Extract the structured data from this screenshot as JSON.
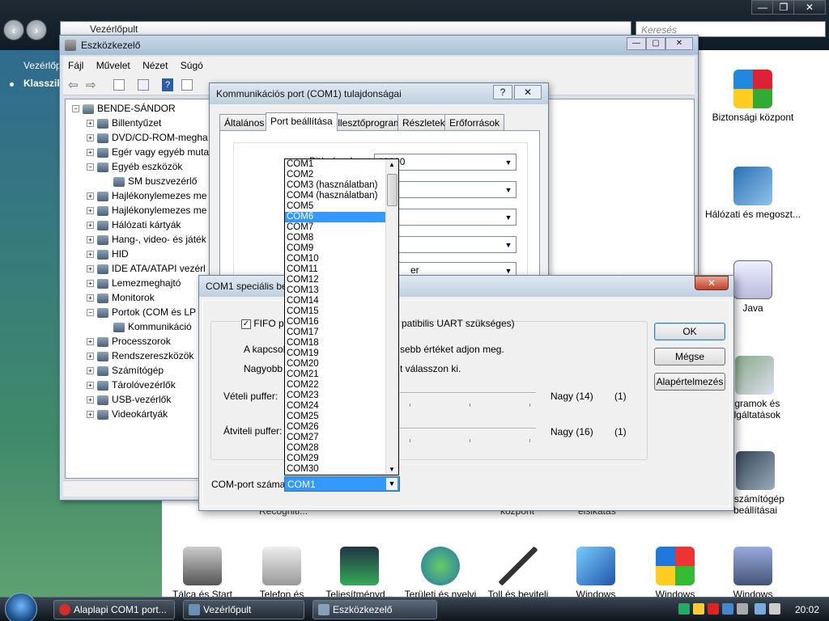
{
  "control_panel": {
    "address": "Vezérlőpult",
    "search_placeholder": "Keresés",
    "left_items": [
      "Vezérlőp",
      "Klasszik"
    ],
    "icons_right": [
      {
        "label": "Biztonsági központ",
        "icon": "security-shield-icon"
      },
      {
        "label": "Hálózati és megoszt...",
        "icon": "network-icon"
      },
      {
        "label": "Java",
        "icon": "java-icon"
      },
      {
        "label": "ogramok és olgáltatások",
        "icon": "programs-icon"
      },
      {
        "label": "ǀaszámítógép beállításai",
        "icon": "tablet-pc-icon"
      }
    ],
    "icons_bottom": [
      {
        "label": "Tálca és Start",
        "icon": "taskbar-icon"
      },
      {
        "label": "Telefon és",
        "icon": "phone-icon"
      },
      {
        "label": "Teljesítményd...",
        "icon": "performance-icon"
      },
      {
        "label": "Területi és nyelvi",
        "icon": "regional-icon"
      },
      {
        "label": "Toll és beviteli",
        "icon": "pen-icon"
      },
      {
        "label": "Windows",
        "icon": "windows-cardspace-icon"
      },
      {
        "label": "Windows",
        "icon": "windows-flag-icon"
      },
      {
        "label": "Windows",
        "icon": "windows-sidebar-icon"
      }
    ],
    "hidden_labels": [
      "Recogniti...",
      "központ",
      "elsikátás"
    ]
  },
  "device_manager": {
    "title": "Eszközkezelő",
    "menu": [
      "Fájl",
      "Művelet",
      "Nézet",
      "Súgó"
    ],
    "root": "BENDE-SÁNDOR",
    "tree": [
      {
        "label": "Billentyűzet",
        "level": 1,
        "toggle": "+"
      },
      {
        "label": "DVD/CD-ROM-megha",
        "level": 1,
        "toggle": "+"
      },
      {
        "label": "Egér vagy egyéb muta",
        "level": 1,
        "toggle": "+"
      },
      {
        "label": "Egyéb eszközök",
        "level": 1,
        "toggle": "−"
      },
      {
        "label": "SM buszvezérlő",
        "level": 2,
        "toggle": ""
      },
      {
        "label": "Hajlékonylemezes me",
        "level": 1,
        "toggle": "+"
      },
      {
        "label": "Hajlékonylemezes me",
        "level": 1,
        "toggle": "+"
      },
      {
        "label": "Hálózati kártyák",
        "level": 1,
        "toggle": "+"
      },
      {
        "label": "Hang-, video- és játék",
        "level": 1,
        "toggle": "+"
      },
      {
        "label": "HID",
        "level": 1,
        "toggle": "+"
      },
      {
        "label": "IDE ATA/ATAPI vezérl",
        "level": 1,
        "toggle": "+"
      },
      {
        "label": "Lemezmeghajtó",
        "level": 1,
        "toggle": "+"
      },
      {
        "label": "Monitorok",
        "level": 1,
        "toggle": "+"
      },
      {
        "label": "Portok (COM és LP",
        "level": 1,
        "toggle": "−"
      },
      {
        "label": "Kommunikáció",
        "level": 2,
        "toggle": ""
      },
      {
        "label": "Processzorok",
        "level": 1,
        "toggle": "+"
      },
      {
        "label": "Rendszereszközök",
        "level": 1,
        "toggle": "+"
      },
      {
        "label": "Számítógép",
        "level": 1,
        "toggle": "+"
      },
      {
        "label": "Tárolóvezérlők",
        "level": 1,
        "toggle": "+"
      },
      {
        "label": "USB-vezérlők",
        "level": 1,
        "toggle": "+"
      },
      {
        "label": "Videokártyák",
        "level": 1,
        "toggle": "+"
      }
    ]
  },
  "properties_dialog": {
    "title": "Kommunikációs port (COM1) tulajdonságai",
    "help": "?",
    "close": "✕",
    "tabs": [
      "Általános",
      "Port beállítása",
      "Illesztőprogram",
      "Részletek",
      "Erőforrások"
    ],
    "active_tab": "Port beállítása",
    "field_label": "Bit/másodperc:",
    "field_value": "19200",
    "partial_value": "er"
  },
  "advanced_dialog": {
    "title": "COM1 speciális be",
    "close": "✕",
    "fifo_label": "FIFO pu",
    "fifo_tail": "patibilis UART szükséges)",
    "fifo_checked": true,
    "hint1_a": "A kapcsola",
    "hint1_b": "sebb értéket adjon meg.",
    "hint2_a": "Nagyobb te",
    "hint2_b": "t válasszon ki.",
    "rx_label": "Vételi puffer:",
    "rx_value": "Nagy (14)",
    "rx_num": "(1)",
    "tx_label": "Átviteli puffer:",
    "tx_value": "Nagy (16)",
    "tx_num": "(1)",
    "ok": "OK",
    "cancel": "Mégse",
    "defaults": "Alapértelmezés",
    "com_label": "COM-port száma:",
    "com_value": "COM1"
  },
  "com_list": {
    "selected": "COM6",
    "options": [
      "COM1",
      "COM2",
      "COM3 (használatban)",
      "COM4 (használatban)",
      "COM5",
      "COM6",
      "COM7",
      "COM8",
      "COM9",
      "COM10",
      "COM11",
      "COM12",
      "COM13",
      "COM14",
      "COM15",
      "COM16",
      "COM17",
      "COM18",
      "COM19",
      "COM20",
      "COM21",
      "COM22",
      "COM23",
      "COM24",
      "COM25",
      "COM26",
      "COM27",
      "COM28",
      "COM29",
      "COM30"
    ]
  },
  "taskbar": {
    "tasks": [
      {
        "label": "Alaplapi COM1 port...",
        "color": "#d62b2b"
      },
      {
        "label": "Vezérlőpult",
        "color": "#6a8fb5"
      },
      {
        "label": "Eszközkezelő",
        "color": "#8aa0b8"
      }
    ],
    "clock": "20:02"
  }
}
